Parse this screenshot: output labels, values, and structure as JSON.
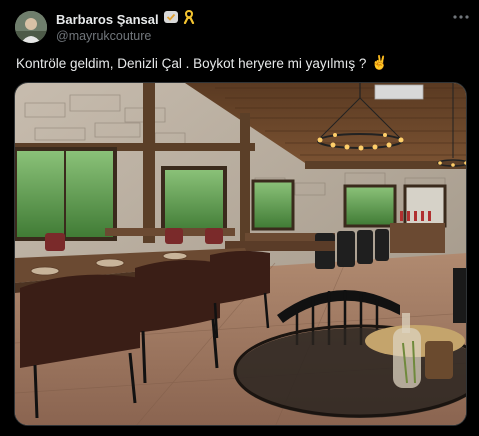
{
  "tweet": {
    "display_name": "Barbaros Şansal",
    "handle": "@mayrukcouture",
    "text": "Kontröle geldim, Denizli Çal . Boykot heryere  mi yayılmış ?",
    "emoji": "✌️",
    "badges": [
      "verified-icon",
      "yellow-ribbon-icon"
    ],
    "more_icon": "more-dots-icon"
  },
  "media": {
    "description_icon": "photo",
    "subject": "restaurant-interior"
  },
  "colors": {
    "background": "#000000",
    "text_primary": "#e7e9ea",
    "text_secondary": "#71767b",
    "ribbon": "#f4c430"
  }
}
